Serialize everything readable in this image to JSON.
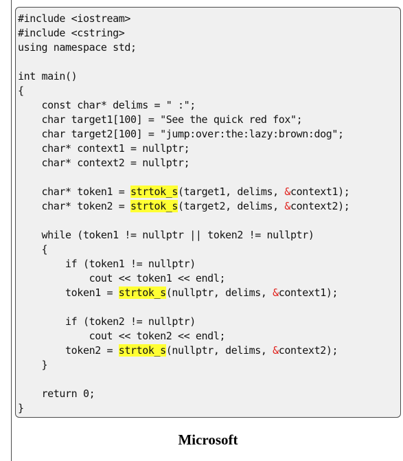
{
  "code": {
    "lines": [
      [
        {
          "t": "#include <iostream>"
        }
      ],
      [
        {
          "t": "#include <cstring>"
        }
      ],
      [
        {
          "t": "using namespace std;"
        }
      ],
      [
        {
          "t": ""
        }
      ],
      [
        {
          "t": "int main()"
        }
      ],
      [
        {
          "t": "{"
        }
      ],
      [
        {
          "t": "    const char* delims = \" :\";"
        }
      ],
      [
        {
          "t": "    char target1[100] = \"See the quick red fox\";"
        }
      ],
      [
        {
          "t": "    char target2[100] = \"jump:over:the:lazy:brown:dog\";"
        }
      ],
      [
        {
          "t": "    char* context1 = nullptr;"
        }
      ],
      [
        {
          "t": "    char* context2 = nullptr;"
        }
      ],
      [
        {
          "t": ""
        }
      ],
      [
        {
          "t": "    char* token1 = "
        },
        {
          "t": "strtok_s",
          "c": "hl"
        },
        {
          "t": "(target1, delims, "
        },
        {
          "t": "&",
          "c": "amp"
        },
        {
          "t": "context1);"
        }
      ],
      [
        {
          "t": "    char* token2 = "
        },
        {
          "t": "strtok_s",
          "c": "hl"
        },
        {
          "t": "(target2, delims, "
        },
        {
          "t": "&",
          "c": "amp"
        },
        {
          "t": "context2);"
        }
      ],
      [
        {
          "t": ""
        }
      ],
      [
        {
          "t": "    while (token1 != nullptr || token2 != nullptr)"
        }
      ],
      [
        {
          "t": "    {"
        }
      ],
      [
        {
          "t": "        if (token1 != nullptr)"
        }
      ],
      [
        {
          "t": "            cout << token1 << endl;"
        }
      ],
      [
        {
          "t": "        token1 = "
        },
        {
          "t": "strtok_s",
          "c": "hl"
        },
        {
          "t": "(nullptr, delims, "
        },
        {
          "t": "&",
          "c": "amp"
        },
        {
          "t": "context1);"
        }
      ],
      [
        {
          "t": ""
        }
      ],
      [
        {
          "t": "        if (token2 != nullptr)"
        }
      ],
      [
        {
          "t": "            cout << token2 << endl;"
        }
      ],
      [
        {
          "t": "        token2 = "
        },
        {
          "t": "strtok_s",
          "c": "hl"
        },
        {
          "t": "(nullptr, delims, "
        },
        {
          "t": "&",
          "c": "amp"
        },
        {
          "t": "context2);"
        }
      ],
      [
        {
          "t": "    }"
        }
      ],
      [
        {
          "t": ""
        }
      ],
      [
        {
          "t": "    return 0;"
        }
      ],
      [
        {
          "t": "}"
        }
      ]
    ]
  },
  "caption": "Microsoft",
  "colors": {
    "highlight": "#ffff33",
    "ampersand": "#e0201b",
    "code_background": "#f0f0f0"
  }
}
